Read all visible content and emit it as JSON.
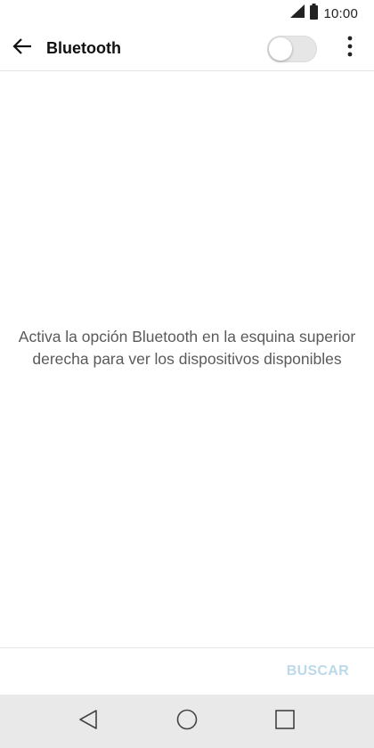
{
  "status_bar": {
    "time": "10:00",
    "signal_icon": "signal-icon",
    "battery_icon": "battery-icon"
  },
  "app_bar": {
    "title": "Bluetooth",
    "back_icon": "arrow-left-icon",
    "toggle_state": "off",
    "overflow_icon": "more-vert-icon"
  },
  "content": {
    "empty_message": "Activa la opción Bluetooth en la esquina superior derecha para ver los dispositivos disponibles"
  },
  "actions": {
    "scan_label": "BUSCAR"
  },
  "nav_bar": {
    "back_icon": "triangle-back-icon",
    "home_icon": "circle-home-icon",
    "recents_icon": "square-recents-icon"
  },
  "colors": {
    "scan_disabled": "#bcd9ea",
    "nav_background": "#e9e9e9",
    "toggle_track_off": "#e6e6e6"
  }
}
